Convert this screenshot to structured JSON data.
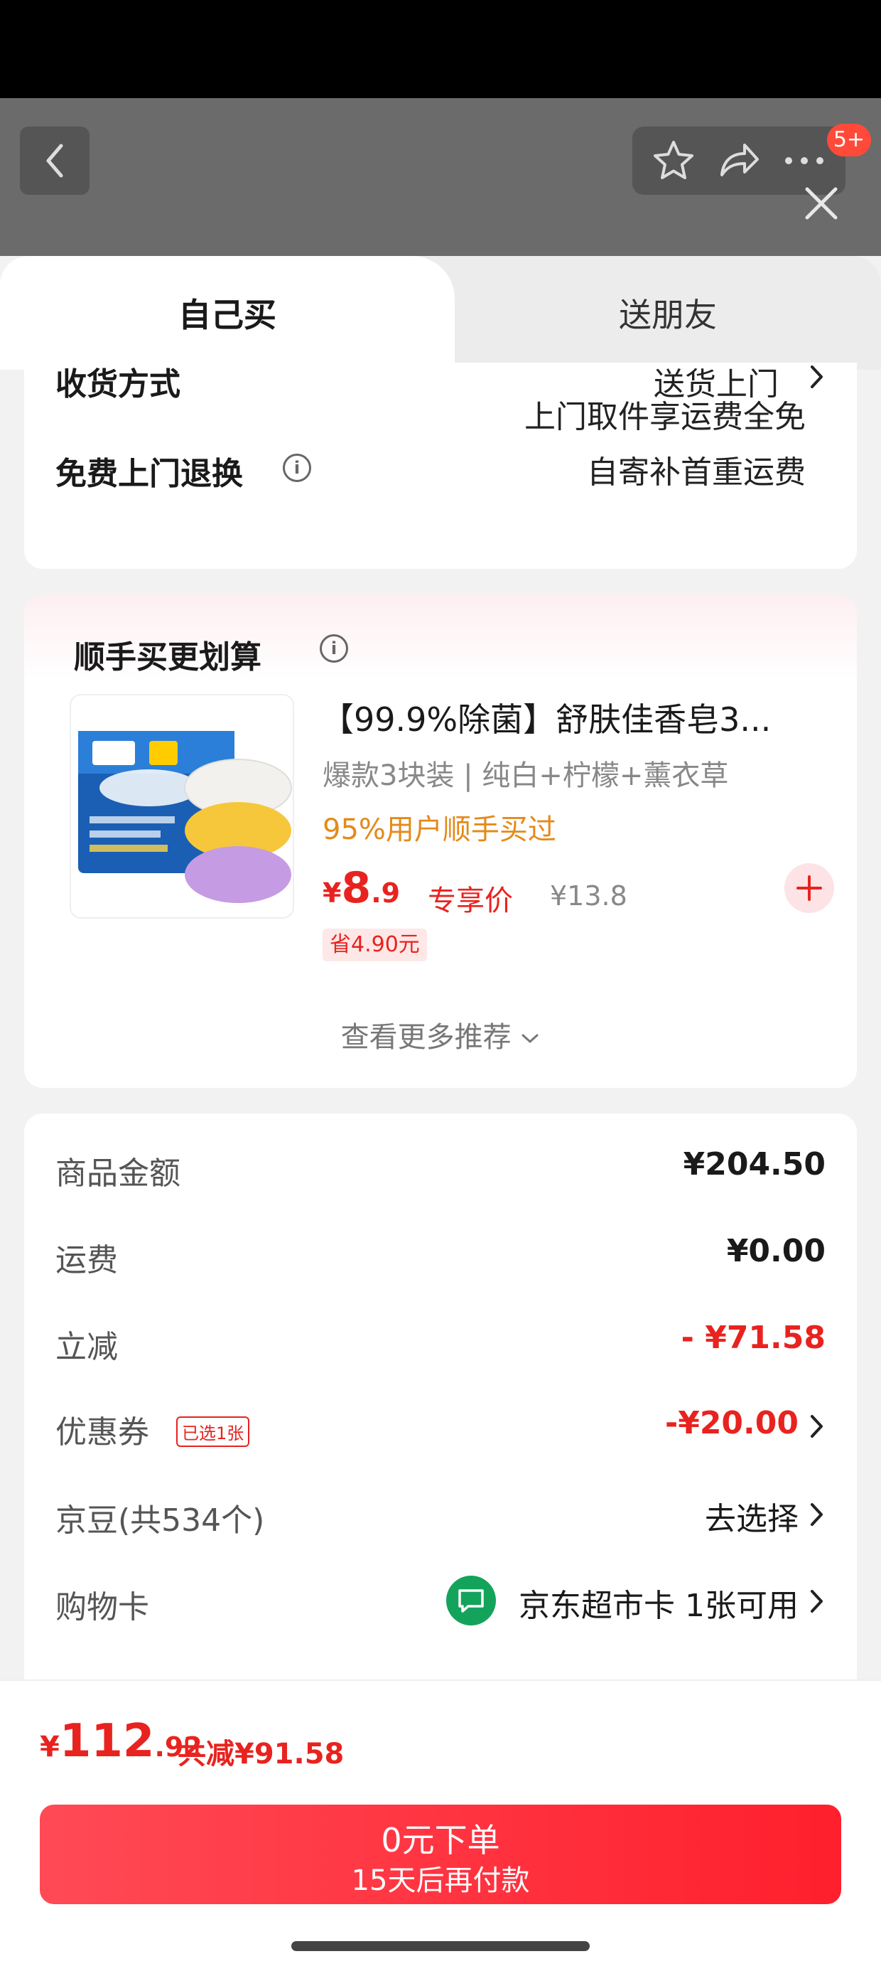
{
  "header": {
    "badge": "5+"
  },
  "tabs": {
    "self_buy": "自己买",
    "gift": "送朋友"
  },
  "delivery": {
    "method_label": "收货方式",
    "method_value": "送货上门",
    "return_label": "免费上门退换",
    "return_line1": "上门取件享运费全免",
    "return_line2": "自寄补首重运费"
  },
  "upsell": {
    "title": "顺手买更划算",
    "product_name": "【99.9%除菌】舒肤佳香皂3...",
    "product_spec": "爆款3块装 | 纯白+柠檬+薰衣草",
    "bought_text": "95%用户顺手买过",
    "price_symbol": "¥",
    "price_int": "8",
    "price_dec": ".9",
    "price_tag": "专享价",
    "orig_price": "¥13.8",
    "save_text": "省4.90元",
    "more_text": "查看更多推荐"
  },
  "summary": {
    "rows": [
      {
        "label": "商品金额",
        "value": "¥204.50"
      },
      {
        "label": "运费",
        "value": "¥0.00"
      },
      {
        "label": "立减",
        "value": "- ¥71.58"
      },
      {
        "label": "优惠券",
        "tag": "已选1张",
        "value": "-¥20.00"
      },
      {
        "label": "京豆(共534个)",
        "value": "去选择"
      },
      {
        "label": "购物卡",
        "value": "京东超市卡 1张可用"
      }
    ]
  },
  "bottom": {
    "symbol": "¥",
    "total_int": "112",
    "total_dec": ".92",
    "total_save": "共减¥91.58",
    "order_main": "0元下单",
    "order_sub": "15天后再付款"
  },
  "colors": {
    "accent": "#e8231f",
    "orange": "#e48a1a",
    "card_green": "#14a35b"
  }
}
